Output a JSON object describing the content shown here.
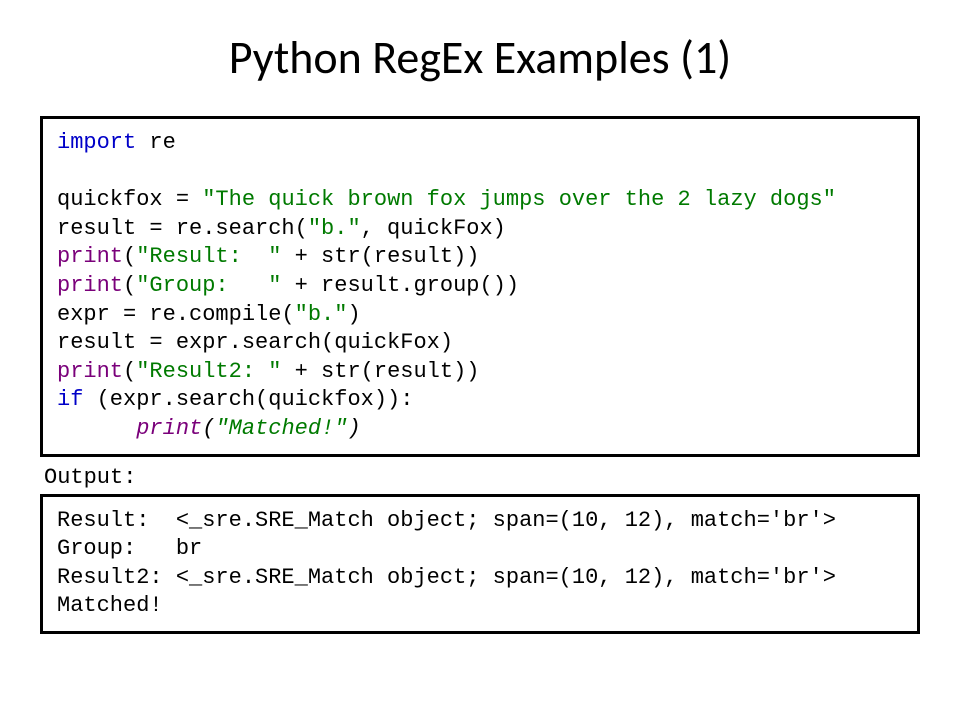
{
  "title": "Python RegEx Examples (1)",
  "code": {
    "kw_import": "import",
    "mod_re": " re",
    "line_blank": "",
    "l2a": "quickfox = ",
    "l2b": "\"The quick brown fox jumps over the 2 lazy dogs\"",
    "l3a": "result = re.search(",
    "l3b": "\"b.\"",
    "l3c": ", quickFox)",
    "l4a": "print",
    "l4b": "(",
    "l4c": "\"Result:  \"",
    "l4d": " + str(result))",
    "l5a": "print",
    "l5b": "(",
    "l5c": "\"Group:   \"",
    "l5d": " + result.group())",
    "l6a": "expr = re.compile(",
    "l6b": "\"b.\"",
    "l6c": ")",
    "l7": "result = expr.search(quickFox)",
    "l8a": "print",
    "l8b": "(",
    "l8c": "\"Result2: \"",
    "l8d": " + str(result))",
    "l9a": "if",
    "l9b": " (expr.search(quickfox)):",
    "l10pad": "      ",
    "l10a": "print",
    "l10b": "(",
    "l10c": "\"Matched!\"",
    "l10d": ")"
  },
  "output_label": "Output:",
  "output": {
    "l1": "Result:  <_sre.SRE_Match object; span=(10, 12), match='br'>",
    "l2": "Group:   br",
    "l3": "Result2: <_sre.SRE_Match object; span=(10, 12), match='br'>",
    "l4": "Matched!"
  }
}
